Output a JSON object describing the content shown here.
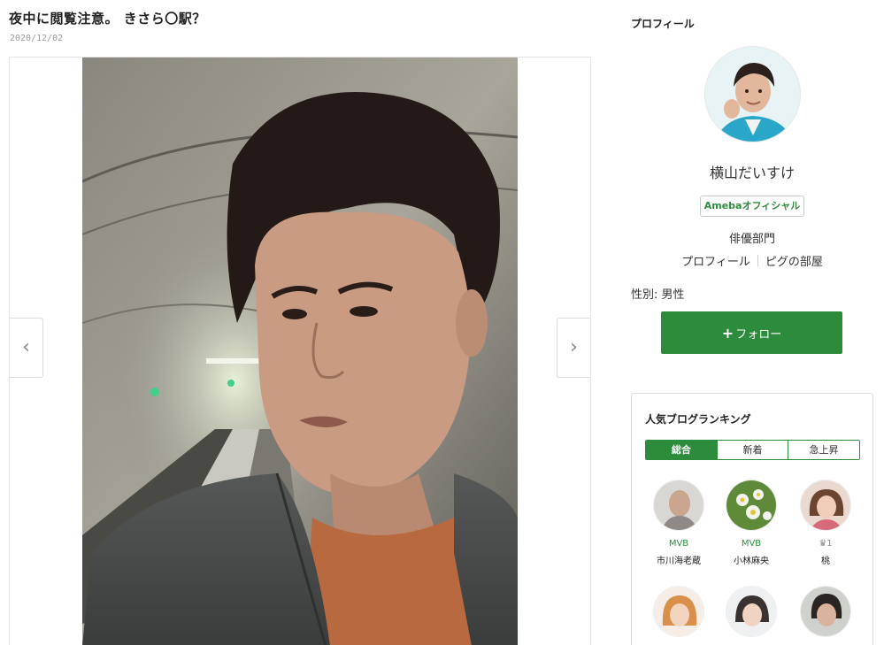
{
  "post": {
    "title": "夜中に閲覧注意。 きさら〇駅？",
    "date": "2020/12/02",
    "prev_arrow": "‹",
    "next_arrow": "›"
  },
  "profile": {
    "heading": "プロフィール",
    "name": "横山だいすけ",
    "badge": "Amebaオフィシャル",
    "category": "俳優部門",
    "link_profile": "プロフィール",
    "link_room": "ピグの部屋",
    "gender": "性別: 男性",
    "follow_icon": "+",
    "follow_label": "フォロー"
  },
  "ranking": {
    "title": "人気ブログランキング",
    "tabs": [
      {
        "label": "総合"
      },
      {
        "label": "新着"
      },
      {
        "label": "急上昇"
      }
    ],
    "items": [
      {
        "badge": "MVB",
        "name": "市川海老蔵"
      },
      {
        "badge": "MVB",
        "name": "小林麻央"
      },
      {
        "badge": "♛1",
        "name": "桃"
      },
      {
        "badge": "",
        "name": ""
      },
      {
        "badge": "",
        "name": ""
      },
      {
        "badge": "",
        "name": ""
      }
    ]
  },
  "colors": {
    "accent_green": "#2d8c3c",
    "border": "#dcdcdc",
    "text": "#333333"
  }
}
